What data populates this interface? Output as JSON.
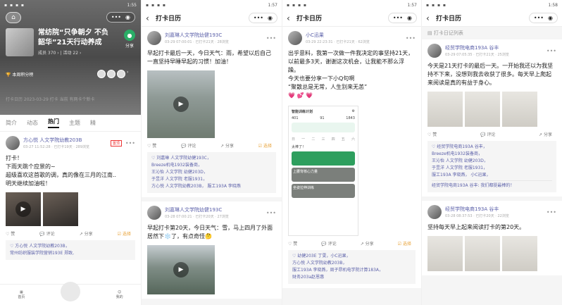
{
  "p1": {
    "status": {
      "left": "▪ ▪ ▪ ▪",
      "right": "1:55"
    },
    "capsule": {
      "dots": "•••",
      "ring": "◉"
    },
    "title": "常纺院“只争朝夕 不负韶华”21天行动养成",
    "meta": "成员 370 › | 活动 22 ›",
    "share": "分享",
    "rank": "本周积分榜",
    "faded": "打卡日历 2023-03-29 打卡 当前 有两卡个新卡",
    "tabs": [
      "简介",
      "动态",
      "热门",
      "主题",
      "精"
    ],
    "post": {
      "name": "方心悦 人文学院幼教203B",
      "meta": "03-27 11:52:28 · 已打卡19天 · 289浏览",
      "badge": "置顶",
      "text": [
        "打卡！",
        "下雨天跳个应景的~",
        "超级喜欢这首歌的调，真的像在三月的江南..",
        "明天继续加油啦！"
      ],
      "likes": [
        "♡ 方心悦 人文学院幼教203B，",
        "常州纺织服装学院营销193E 郑致,"
      ]
    },
    "actions": {
      "like": "♡ 赞",
      "comment": "评论",
      "share": "分享",
      "select": "选择"
    },
    "bottom": {
      "left": "首页",
      "right": "我的"
    }
  },
  "p2": {
    "status": {
      "right": "1:57"
    },
    "title": "打卡日历",
    "posts": [
      {
        "name": "刘嘉琳人文学院幼健193C",
        "meta": "03-29 07:00:01 · 已打卡21天 · 28浏览",
        "text": "早起打卡最后一天，今日天气：雨，希望以后自己一直坚持早睡早起的习惯！加油！",
        "likes": [
          "♡ 刘嘉琳 人文学院幼健193C，",
          "Breeze机电1932装备商，",
          "王沁怡 人文学院 幼健203D，",
          "于昱洋 人文学院 老服1931，",
          "方心悦 人文学院幼教203B， 服工193A 李晓燕"
        ]
      },
      {
        "name": "刘嘉琳人文学院幼健193C",
        "meta": "03-28 07:00:21 · 已打卡20天 · 27浏览",
        "text": "早起打卡第20天，今日天气：雪，马上四月了外面居然下❄️了，有点奇怪🤔"
      }
    ]
  },
  "p3": {
    "status": {
      "right": "1:57"
    },
    "title": "打卡日历",
    "post": {
      "name": "小C迅果",
      "meta": "03-29 22:23:31 · 已打卡21天 · 62浏览",
      "text": [
        "出乎意料，我第一次做一件我决定的事坚持21天，以前最多3天，谢谢这次机会，让我能不那么浮躁。",
        "今天也要分享一下小Q句啊",
        "“聚散总是无常，人生别来无恙”"
      ],
      "emoji": "💗 💕 💗",
      "screen": {
        "title": "智能训练计划",
        "nums": [
          "401",
          "91",
          "1843"
        ],
        "card1": "太棒了！",
        "card2": "上腰背核心力量",
        "card3": "坐姿拉伸训练"
      },
      "likes": [
        "♡ 幼健203E 丁雯，小C迅果，",
        "方心悦 人文学院幼教203B，",
        "服工193A 李晓燕，周子昂机电学院计算183A，",
        "财务203a赵恩惠"
      ]
    }
  },
  "p4": {
    "status": {
      "right": "1:58"
    },
    "title": "打卡日记列表",
    "posts": [
      {
        "name": "经贸学院电商193A 谷丰",
        "meta": "03-29 07:05:35 · 已打卡21天 · 25浏览",
        "text": "今天是21天打卡的最后一天。一开始我还以为我坚持不下来，没想到我去收获了很多。每天早上爬起来阅读是真的有益于身心。",
        "likes": [
          "♡ 经贸学院电商193A 谷丰，",
          "Breeze机电1932装备商，",
          "王沁怡 人文学院 幼健203D，",
          "于昱洋 人文学院 老服1931，",
          "服工193A 李晓燕， 小C迅果，",
          "经贸学院电商193A 谷丰: 我们都挺最棒的！"
        ]
      },
      {
        "name": "经贸学院电商193A 谷丰",
        "meta": "03-28 08:37:53 · 已打卡20天 · 22浏览",
        "text": "坚持每天早上起来阅读打卡的第20天。"
      }
    ]
  }
}
